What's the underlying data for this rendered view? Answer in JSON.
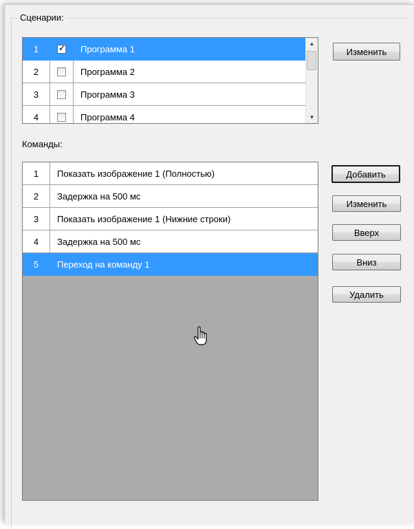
{
  "scenarios": {
    "label": "Сценарии:",
    "rows": [
      {
        "num": "1",
        "checked": true,
        "name": "Программа 1",
        "selected": true
      },
      {
        "num": "2",
        "checked": false,
        "name": "Программа 2",
        "selected": false
      },
      {
        "num": "3",
        "checked": false,
        "name": "Программа 3",
        "selected": false
      },
      {
        "num": "4",
        "checked": false,
        "name": "Программа 4",
        "selected": false
      }
    ],
    "edit_button": "Изменить"
  },
  "commands": {
    "label": "Команды:",
    "rows": [
      {
        "num": "1",
        "text": "Показать изображение 1 (Полностью)",
        "selected": false
      },
      {
        "num": "2",
        "text": "Задержка на 500 мс",
        "selected": false
      },
      {
        "num": "3",
        "text": "Показать изображение 1 (Нижние строки)",
        "selected": false
      },
      {
        "num": "4",
        "text": "Задержка на 500 мс",
        "selected": false
      },
      {
        "num": "5",
        "text": "Переход на команду 1",
        "selected": true
      }
    ],
    "buttons": {
      "add": "Добавить",
      "edit": "Изменить",
      "up": "Вверх",
      "down": "Вниз",
      "delete": "Удалить"
    }
  },
  "colors": {
    "selection": "#3399ff",
    "empty_grid": "#ababab",
    "panel": "#f0f0f0"
  }
}
